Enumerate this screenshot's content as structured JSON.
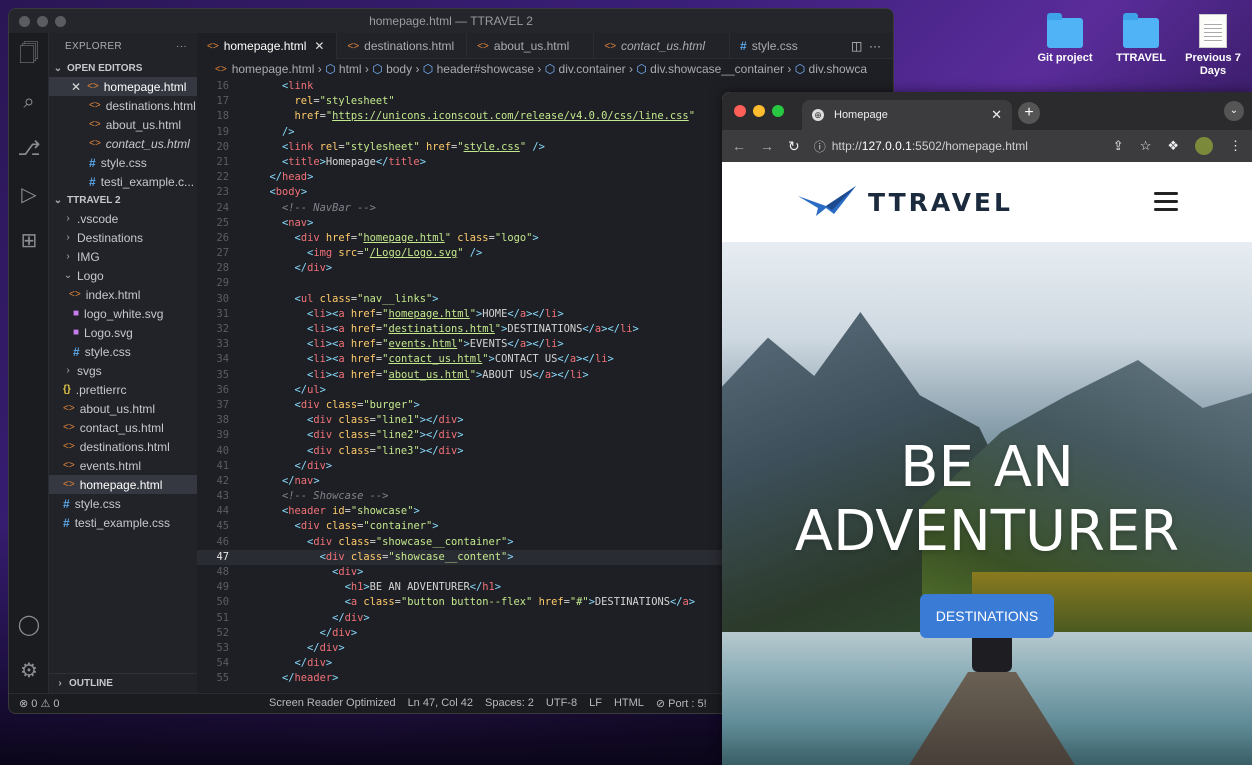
{
  "desktop": {
    "icons": [
      {
        "label": "Git project",
        "icon": "folder-icon"
      },
      {
        "label": "TTRAVEL",
        "icon": "folder-icon"
      },
      {
        "label": "Previous 7 Days",
        "icon": "document-icon"
      }
    ]
  },
  "vscode": {
    "window_title": "homepage.html — TTRAVEL 2",
    "explorer_title": "EXPLORER",
    "explorer_more": "···",
    "open_editors_label": "OPEN EDITORS",
    "open_editors": [
      "homepage.html",
      "destinations.html",
      "about_us.html",
      "contact_us.html",
      "style.css",
      "testi_example.c..."
    ],
    "project_label": "TTRAVEL 2",
    "tree": [
      ".vscode",
      "Destinations",
      "IMG",
      "Logo",
      "index.html",
      "logo_white.svg",
      "Logo.svg",
      "style.css",
      "svgs",
      ".prettierrc",
      "about_us.html",
      "contact_us.html",
      "destinations.html",
      "events.html",
      "homepage.html",
      "style.css",
      "testi_example.css"
    ],
    "outline_label": "OUTLINE",
    "tabs": [
      "homepage.html",
      "destinations.html",
      "about_us.html",
      "contact_us.html",
      "style.css"
    ],
    "breadcrumbs": [
      "homepage.html",
      "html",
      "body",
      "header#showcase",
      "div.container",
      "div.showcase__container",
      "div.showca"
    ],
    "line_numbers": [
      "16",
      "17",
      "18",
      "19",
      "20",
      "21",
      "22",
      "23",
      "24",
      "25",
      "26",
      "27",
      "28",
      "29",
      "30",
      "31",
      "32",
      "33",
      "34",
      "35",
      "36",
      "37",
      "38",
      "39",
      "40",
      "41",
      "42",
      "43",
      "44",
      "45",
      "46",
      "47",
      "48",
      "49",
      "50",
      "51",
      "52",
      "53",
      "54",
      "55"
    ],
    "status": {
      "problems": "⊗ 0 ⚠ 0",
      "screen_reader": "Screen Reader Optimized",
      "position": "Ln 47, Col 42",
      "spaces": "Spaces: 2",
      "encoding": "UTF-8",
      "eol": "LF",
      "language": "HTML",
      "port": "⊘ Port : 5!"
    }
  },
  "browser": {
    "tab_title": "Homepage",
    "url_prefix": "http://",
    "url_host": "127.0.0.1",
    "url_rest": ":5502/homepage.html",
    "site_logo": "TTRAVEL",
    "hero_title": "BE AN ADVENTURER",
    "hero_button": "DESTINATIONS"
  },
  "colors": {
    "accent": "#3a7bd5",
    "vscode_bg": "#1e1f24",
    "html_icon": "#e0843a",
    "css_icon": "#5aa6e8"
  }
}
